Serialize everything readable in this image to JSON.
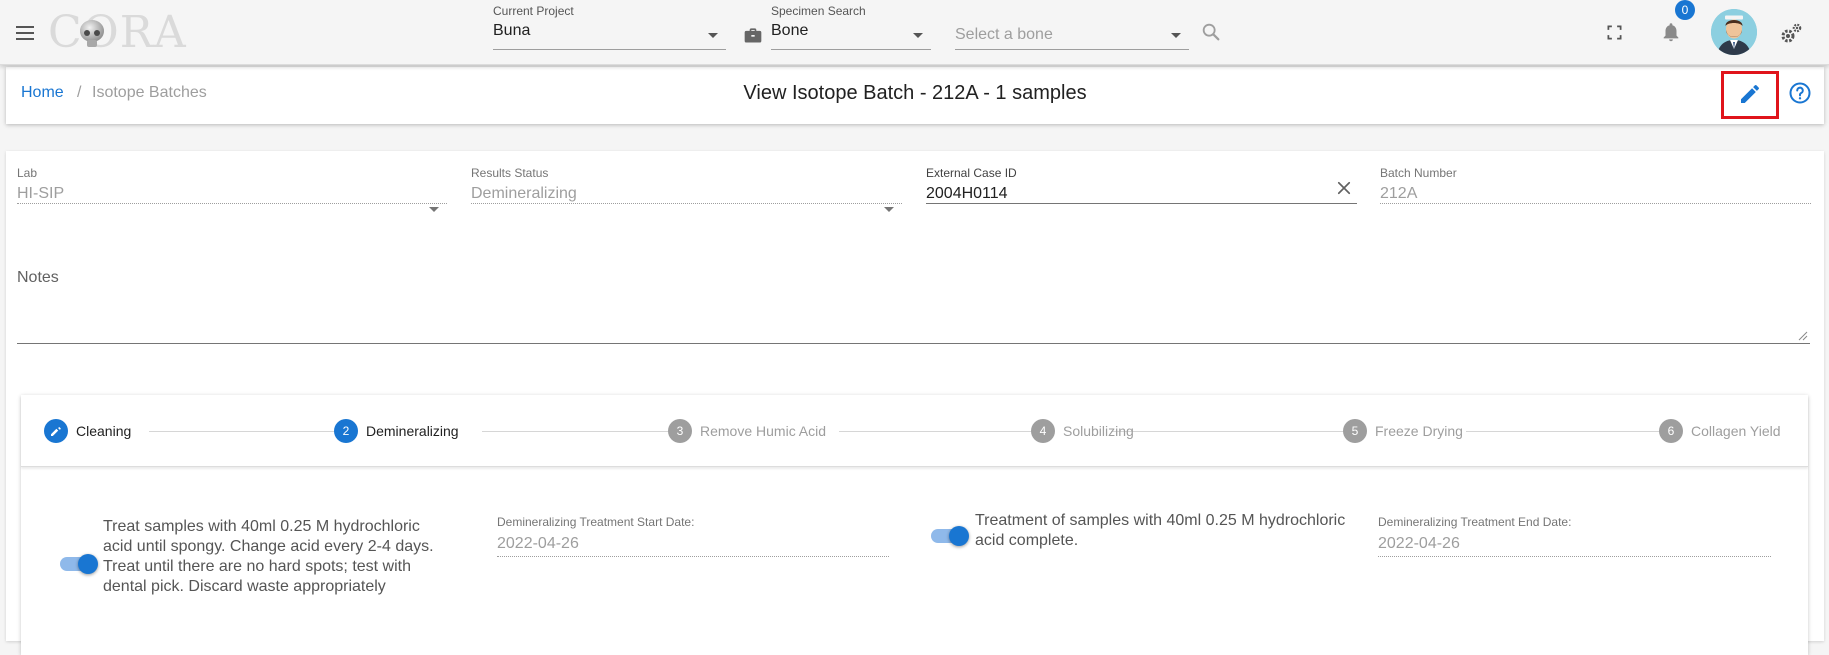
{
  "app": {
    "logo_text": "CORA"
  },
  "topbar": {
    "current_project": {
      "label": "Current Project",
      "value": "Buna"
    },
    "specimen_search": {
      "label": "Specimen Search",
      "value": "Bone"
    },
    "bone_select": {
      "placeholder": "Select a bone"
    },
    "notification_count": "0",
    "icons": [
      "menu-icon",
      "briefcase-icon",
      "search-icon",
      "fullscreen-icon",
      "bell-icon",
      "settings-icon"
    ]
  },
  "breadcrumb": {
    "home": "Home",
    "separator": "/",
    "current": "Isotope Batches"
  },
  "page": {
    "title": "View Isotope Batch - 212A - 1 samples"
  },
  "form": {
    "lab": {
      "label": "Lab",
      "value": "HI-SIP"
    },
    "results_status": {
      "label": "Results Status",
      "value": "Demineralizing"
    },
    "external_case_id": {
      "label": "External Case ID",
      "value": "2004H0114"
    },
    "batch_number": {
      "label": "Batch Number",
      "value": "212A"
    },
    "notes": {
      "label": "Notes",
      "value": ""
    }
  },
  "stepper": {
    "steps": [
      {
        "label": "Cleaning",
        "number": "",
        "state": "complete"
      },
      {
        "label": "Demineralizing",
        "number": "2",
        "state": "active"
      },
      {
        "label": "Remove Humic Acid",
        "number": "3",
        "state": "inactive"
      },
      {
        "label": "Solubilizing",
        "number": "4",
        "state": "inactive"
      },
      {
        "label": "Freeze Drying",
        "number": "5",
        "state": "inactive"
      },
      {
        "label": "Collagen Yield",
        "number": "6",
        "state": "inactive"
      }
    ],
    "demineralizing": {
      "treat_toggle": {
        "on": true,
        "text": "Treat samples with 40ml 0.25 M hydrochloric acid until spongy. Change acid every 2-4 days. Treat until there are no hard spots; test with dental pick. Discard waste appropriately"
      },
      "start_date": {
        "label": "Demineralizing Treatment Start Date:",
        "value": "2022-04-26"
      },
      "complete_toggle": {
        "on": true,
        "text": "Treatment of samples with 40ml 0.25 M hydrochloric acid complete."
      },
      "end_date": {
        "label": "Demineralizing Treatment End Date:",
        "value": "2022-04-26"
      }
    }
  },
  "colors": {
    "primary": "#1976d2",
    "highlight_box": "#e0141b",
    "inactive_step": "#9e9e9e"
  }
}
